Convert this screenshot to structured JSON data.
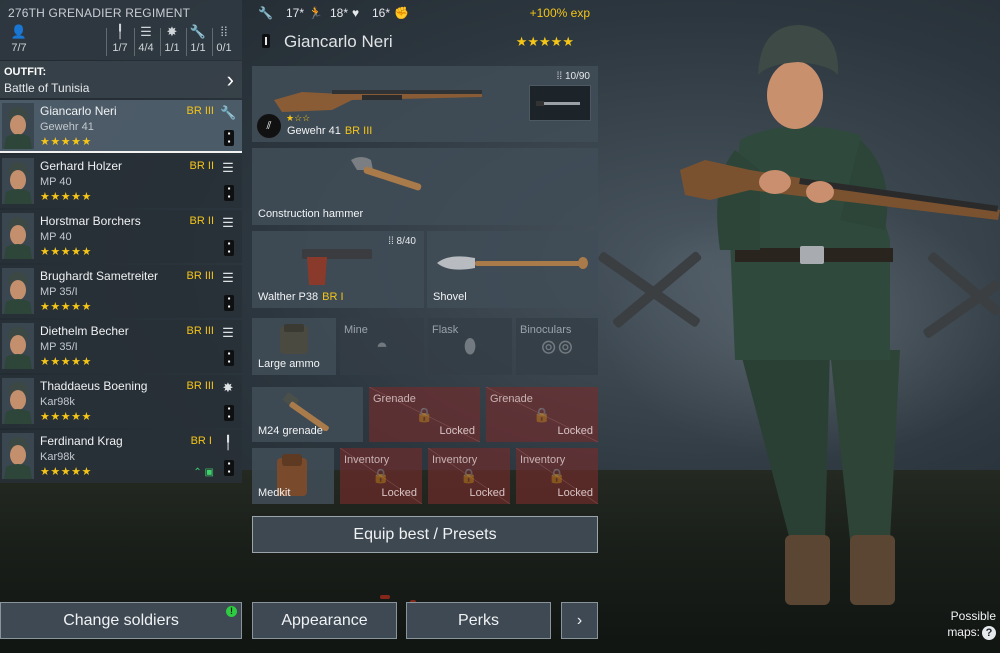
{
  "squad": {
    "regiment": "276TH GRENADIER REGIMENT",
    "stats": [
      {
        "icon": "person-icon",
        "glyph": "👤",
        "value": "7/7"
      },
      {
        "icon": "rifle-icon",
        "glyph": "╿",
        "value": "1/7"
      },
      {
        "icon": "list-icon",
        "glyph": "☰",
        "value": "4/4"
      },
      {
        "icon": "explosion-icon",
        "glyph": "✸",
        "value": "1/1"
      },
      {
        "icon": "wrench-icon",
        "glyph": "🔧",
        "value": "1/1"
      },
      {
        "icon": "ammo-icon",
        "glyph": "⁞⁞",
        "value": "0/1"
      }
    ],
    "outfit_label": "OUTFIT:",
    "outfit_value": "Battle of Tunisia",
    "members": [
      {
        "name": "Giancarlo Neri",
        "weapon": "Gewehr 41",
        "br": "BR III",
        "stars": "★★★★★",
        "class_icon": "wrench-icon"
      },
      {
        "name": "Gerhard Holzer",
        "weapon": "MP 40",
        "br": "BR II",
        "stars": "★★★★★",
        "class_icon": "list-icon"
      },
      {
        "name": "Horstmar Borchers",
        "weapon": "MP 40",
        "br": "BR II",
        "stars": "★★★★★",
        "class_icon": "list-icon"
      },
      {
        "name": "Brughardt Sametreiter",
        "weapon": "MP 35/I",
        "br": "BR III",
        "stars": "★★★★★",
        "class_icon": "list-icon"
      },
      {
        "name": "Diethelm Becher",
        "weapon": "MP 35/I",
        "br": "BR III",
        "stars": "★★★★★",
        "class_icon": "list-icon"
      },
      {
        "name": "Thaddaeus Boening",
        "weapon": "Kar98k",
        "br": "BR III",
        "stars": "★★★★★",
        "class_icon": "explosion-icon"
      },
      {
        "name": "Ferdinand Krag",
        "weapon": "Kar98k",
        "br": "BR I",
        "stars": "★★★★★",
        "class_icon": "rifle-icon"
      }
    ]
  },
  "soldier": {
    "stats": [
      {
        "icon": "wrench-icon",
        "value": ""
      },
      {
        "icon": "run-icon",
        "value": "17*"
      },
      {
        "icon": "heart-icon",
        "value": "18*"
      },
      {
        "icon": "fist-icon",
        "value": "16*"
      }
    ],
    "exp_bonus": "+100% exp",
    "name": "Giancarlo Neri",
    "stars": "★★★★★"
  },
  "equipment": {
    "primary": {
      "name": "Gewehr 41",
      "br": "BR III",
      "ammo": "10/90",
      "weapon_stars": "★☆☆"
    },
    "melee": {
      "name": "Construction hammer"
    },
    "secondary": {
      "name": "Walther P38",
      "br": "BR I",
      "ammo": "8/40"
    },
    "tool": {
      "name": "Shovel"
    },
    "backpack": {
      "name": "Large ammo"
    },
    "utility_slots": [
      "Mine",
      "Flask",
      "Binoculars"
    ],
    "grenade": {
      "name": "M24 grenade"
    },
    "grenade_locked": [
      {
        "label": "Grenade",
        "state": "Locked"
      },
      {
        "label": "Grenade",
        "state": "Locked"
      }
    ],
    "medkit": {
      "name": "Medkit"
    },
    "inventory_locked": [
      {
        "label": "Inventory",
        "state": "Locked"
      },
      {
        "label": "Inventory",
        "state": "Locked"
      },
      {
        "label": "Inventory",
        "state": "Locked"
      }
    ]
  },
  "actions": {
    "equip_best": "Equip best  /  Presets",
    "change_soldiers": "Change soldiers",
    "change_soldiers_badge": "!",
    "appearance": "Appearance",
    "perks": "Perks",
    "more": "›"
  },
  "maps": {
    "label_line1": "Possible",
    "label_line2": "maps:",
    "help": "?"
  },
  "colors": {
    "accent": "#f5c518",
    "locked": "#7a2c2c",
    "panel": "#404c56",
    "notify": "#2ecc40"
  }
}
